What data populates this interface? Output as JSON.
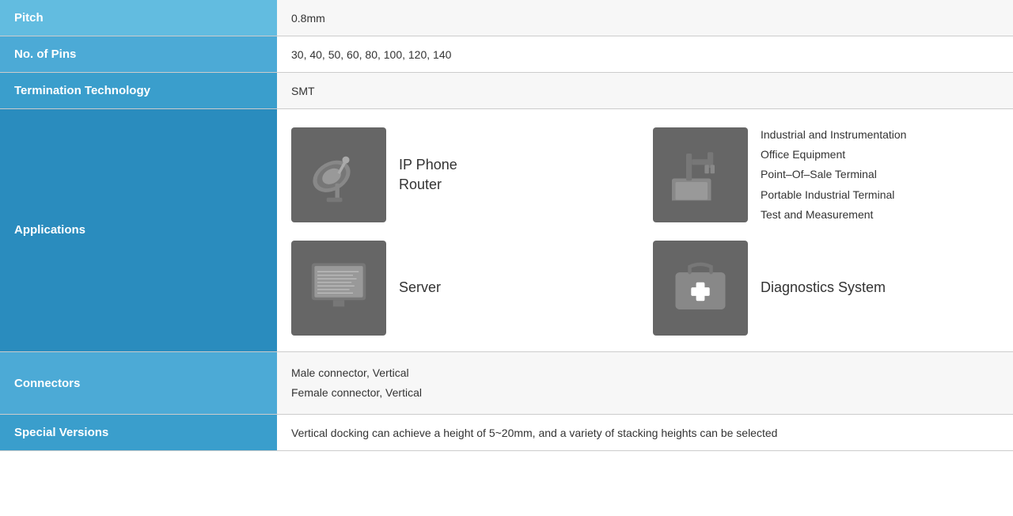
{
  "rows": {
    "pitch": {
      "label": "Pitch",
      "value": "0.8mm"
    },
    "pins": {
      "label": "No. of Pins",
      "value": "30, 40, 50, 60, 80, 100, 120, 140"
    },
    "termination": {
      "label": "Termination Technology",
      "value": "SMT"
    },
    "applications": {
      "label": "Applications",
      "items": [
        {
          "icon": "satellite-dish",
          "label": "IP Phone\nRouter"
        },
        {
          "icon": "industrial",
          "lines": [
            "Industrial and Instrumentation",
            "Office Equipment",
            "Point–Of–Sale Terminal",
            "Portable Industrial Terminal",
            "Test and Measurement"
          ]
        },
        {
          "icon": "server",
          "label": "Server"
        },
        {
          "icon": "diagnostics",
          "label": "Diagnostics System"
        }
      ]
    },
    "connectors": {
      "label": "Connectors",
      "line1": "Male connector, Vertical",
      "line2": "Female connector, Vertical"
    },
    "special": {
      "label": "Special Versions",
      "value": "Vertical docking can achieve a height of 5~20mm, and a variety of stacking heights can be selected"
    }
  }
}
